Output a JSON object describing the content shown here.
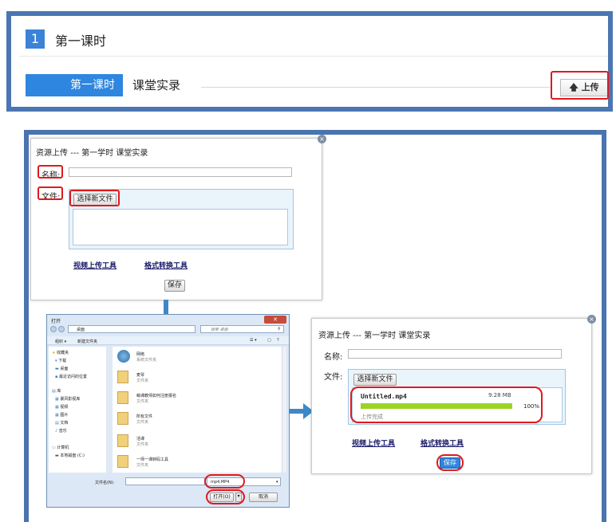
{
  "top": {
    "course_number": "1",
    "course_title": "第一课时",
    "lesson_tag": "第一课时",
    "lesson_name": "课堂实录",
    "upload_label": "上传",
    "upload_icon": "up-arrow-icon"
  },
  "dialog1": {
    "title": "资源上传 --- 第一学时 课堂实录",
    "name_label": "名称:",
    "file_label": "文件:",
    "choose_button": "选择新文件",
    "link_video_upload": "视频上传工具",
    "link_format_convert": "格式转换工具",
    "save_button": "保存"
  },
  "dialog2": {
    "title": "资源上传 --- 第一学时 课堂实录",
    "name_label": "名称:",
    "file_label": "文件:",
    "choose_button": "选择新文件",
    "file_name": "Untitled.mp4",
    "file_size": "9.28 MB",
    "progress_text": "100%",
    "progress_value": 1.0,
    "status_text": "上传完成",
    "link_video_upload": "视频上传工具",
    "link_format_convert": "格式转换工具",
    "save_button": "保存"
  },
  "open_dialog": {
    "title": "打开",
    "path": "桌面",
    "search_placeholder": "搜索 桌面",
    "organize": "组织 ▾",
    "new_folder": "新建文件夹",
    "sidebar": [
      "收藏夹",
      "下载",
      "桌面",
      "最近访问的位置",
      "库",
      "暴风影视库",
      "视频",
      "图片",
      "文档",
      "音乐",
      "计算机",
      "本地磁盘 (C:)"
    ],
    "files": [
      {
        "name": "网络",
        "type": "系统文件夹"
      },
      {
        "name": "麦琴",
        "type": "文件夹"
      },
      {
        "name": "萌课教师如何注册报名",
        "type": "文件夹"
      },
      {
        "name": "所有文件",
        "type": "文件夹"
      },
      {
        "name": "活课",
        "type": "文件夹"
      },
      {
        "name": "一师一课转码工具",
        "type": "文件夹"
      }
    ],
    "filename_label": "文件名(N):",
    "filter": "mp4,MP4",
    "open_button": "打开(O)",
    "cancel_button": "取消"
  },
  "colors": {
    "panel_border": "#4b76b1",
    "accent_blue": "#2e86e0",
    "highlight_red": "#e0191e",
    "progress_green": "#9bd424"
  }
}
